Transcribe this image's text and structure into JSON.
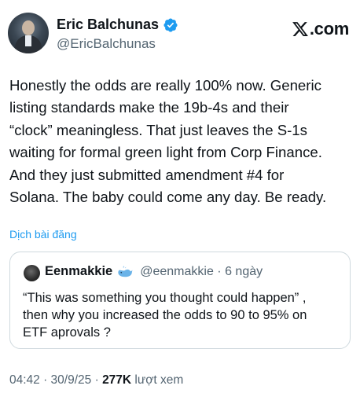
{
  "author": {
    "display_name": "Eric Balchunas",
    "handle": "@EricBalchunas",
    "verified": true,
    "verified_color": "#1d9bf0"
  },
  "brand": {
    "logo_text": ".com",
    "logo_icon": "x-logo-icon"
  },
  "tweet": {
    "text": "Honestly the odds are really 100% now. Generic\nlisting standards make the 19b-4s and their\n“clock” meaningless. That just leaves the S-1s\nwaiting for formal green light from Corp Finance.\nAnd they just submitted amendment #4 for\nSolana. The baby could come any day. Be ready.",
    "translate_label": "Dịch bài đăng"
  },
  "quote": {
    "display_name": "Eenmakkie",
    "badge_icon": "whale-icon",
    "handle_time": "@eenmakkie · 6 ngày",
    "text": "“This was something you thought could happen” ,\nthen why you increased the odds to 90 to 95% on\nETF aprovals ?"
  },
  "meta": {
    "time_date": "04:42 · 30/9/25 · ",
    "views_count": "277K",
    "views_label": " lượt xem"
  },
  "colors": {
    "text": "#0f1419",
    "secondary": "#536471",
    "link": "#1d9bf0",
    "border": "#cfd9de"
  }
}
